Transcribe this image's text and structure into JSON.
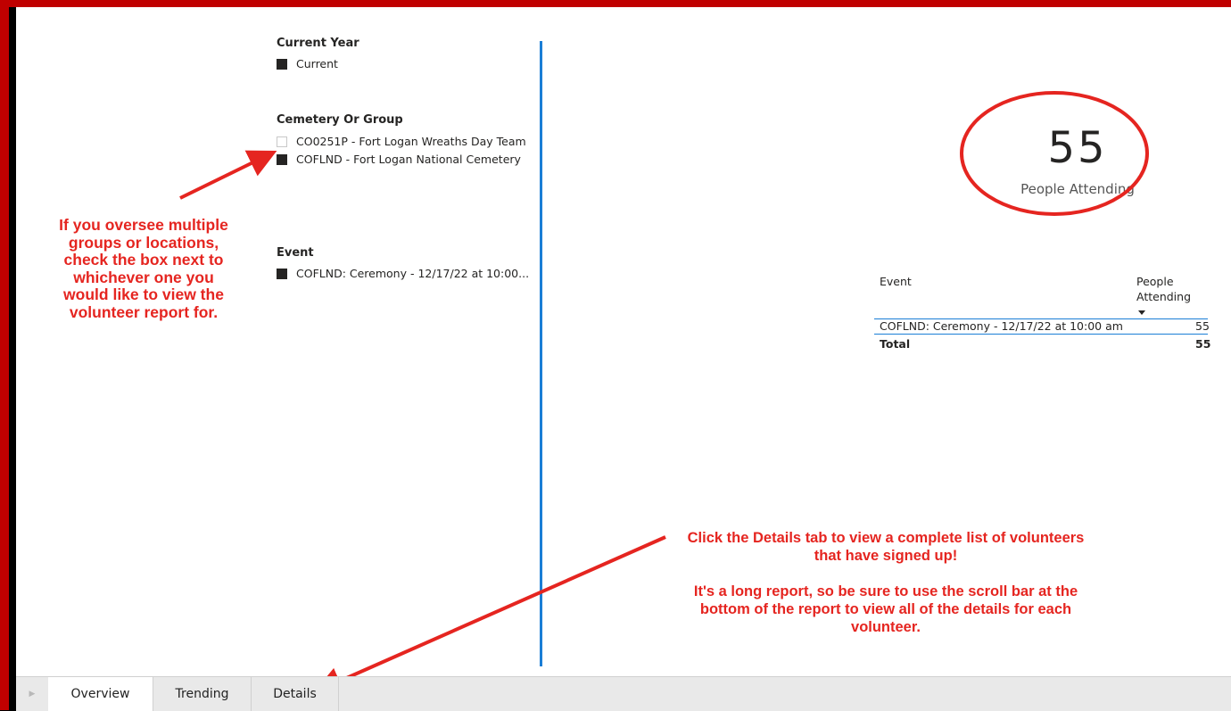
{
  "slicers": {
    "current_year": {
      "title": "Current Year",
      "items": [
        {
          "label": "Current",
          "checked": true
        }
      ]
    },
    "cemetery": {
      "title": "Cemetery Or Group",
      "items": [
        {
          "label": "CO0251P - Fort Logan Wreaths Day Team",
          "checked": false
        },
        {
          "label": "COFLND - Fort Logan National Cemetery",
          "checked": true
        }
      ]
    },
    "event": {
      "title": "Event",
      "items": [
        {
          "label": "COFLND: Ceremony - 12/17/22 at 10:00...",
          "checked": true
        }
      ]
    }
  },
  "kpi": {
    "value": "55",
    "label": "People Attending"
  },
  "table": {
    "headers": {
      "event": "Event",
      "people_line1": "People",
      "people_line2": "Attending"
    },
    "rows": [
      {
        "event": "COFLND: Ceremony - 12/17/22 at 10:00 am",
        "people": "55"
      }
    ],
    "total": {
      "label": "Total",
      "people": "55"
    }
  },
  "annotations": {
    "left": "If you oversee multiple groups or locations, check the box next to whichever one you would like to view the volunteer report for.",
    "right_line1": "Click the Details tab to view a complete list of volunteers that have signed up!",
    "right_line2": "It's a long report, so be sure to use the scroll bar at the bottom of the report to view all of the details for each volunteer."
  },
  "tabs": {
    "overview": "Overview",
    "trending": "Trending",
    "details": "Details"
  },
  "colors": {
    "frame": "#c00000",
    "annotation": "#e52520",
    "divider": "#1b7ed6"
  }
}
